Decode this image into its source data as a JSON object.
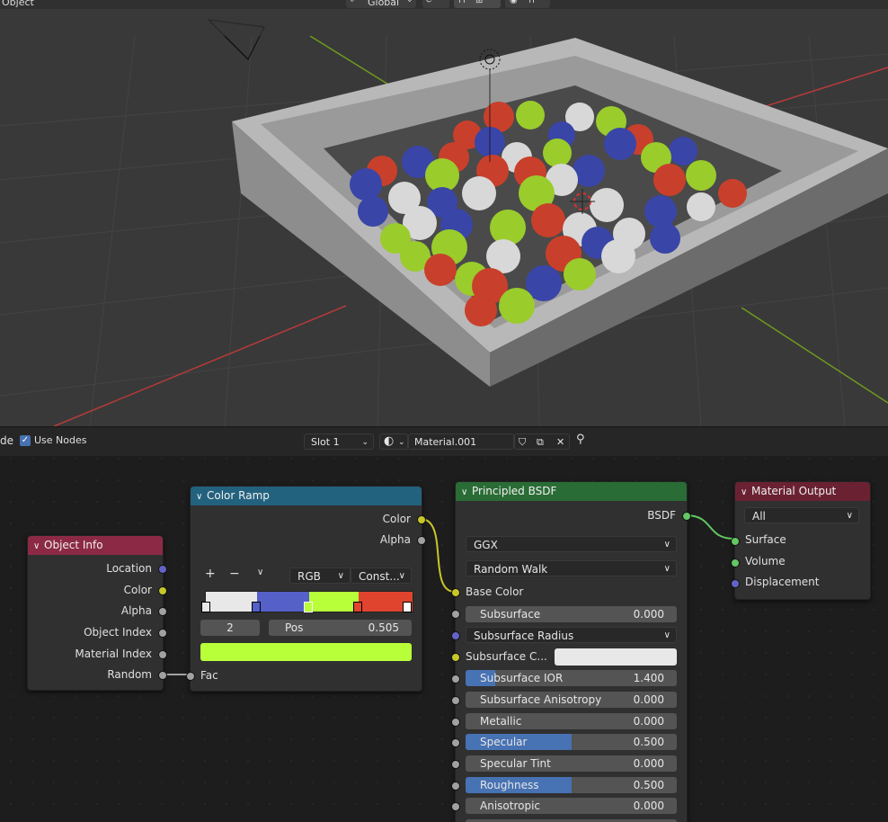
{
  "viewport_header": {
    "mode_label": "Object",
    "transform_orientation": "Global"
  },
  "node_editor_header": {
    "left_cut_label": "de",
    "use_nodes_label": "Use Nodes",
    "use_nodes_checked": true,
    "slot_label": "Slot 1",
    "material_name": "Material.001"
  },
  "nodes": {
    "object_info": {
      "title": "Object Info",
      "outputs": [
        "Location",
        "Color",
        "Alpha",
        "Object Index",
        "Material Index",
        "Random"
      ]
    },
    "color_ramp": {
      "title": "Color Ramp",
      "outputs": [
        "Color",
        "Alpha"
      ],
      "add_label": "+",
      "remove_label": "−",
      "color_mode": "RGB",
      "interpolation": "Const...",
      "active_index": "2",
      "pos_label": "Pos",
      "pos_value": "0.505",
      "input_label": "Fac",
      "stops": [
        "#e8e8e8",
        "#5560c8",
        "#b8ff3a",
        "#e0442e"
      ],
      "active_color": "#b8ff3a"
    },
    "principled_bsdf": {
      "title": "Principled BSDF",
      "output": "BSDF",
      "distribution": "GGX",
      "subsurface_method": "Random Walk",
      "base_color_label": "Base Color",
      "subsurface": {
        "label": "Subsurface",
        "value": "0.000"
      },
      "subsurface_radius": "Subsurface Radius",
      "subsurface_color_label": "Subsurface C...",
      "subsurface_ior": {
        "label": "Subsurface IOR",
        "value": "1.400",
        "fill": 0.14
      },
      "subsurface_anisotropy": {
        "label": "Subsurface Anisotropy",
        "value": "0.000"
      },
      "metallic": {
        "label": "Metallic",
        "value": "0.000"
      },
      "specular": {
        "label": "Specular",
        "value": "0.500",
        "fill": 0.5
      },
      "specular_tint": {
        "label": "Specular Tint",
        "value": "0.000"
      },
      "roughness": {
        "label": "Roughness",
        "value": "0.500",
        "fill": 0.5
      },
      "anisotropic": {
        "label": "Anisotropic",
        "value": "0.000"
      }
    },
    "material_output": {
      "title": "Material Output",
      "target": "All",
      "inputs": [
        "Surface",
        "Volume",
        "Displacement"
      ]
    }
  },
  "colors": {
    "object_info_header": "#8c2a45",
    "color_ramp_header": "#23627e",
    "bsdf_header": "#2a6c35",
    "output_header": "#6a2233",
    "socket_vector": "#6363c7",
    "socket_color": "#c7c729",
    "socket_float": "#a1a1a1",
    "socket_shader": "#63c763"
  }
}
